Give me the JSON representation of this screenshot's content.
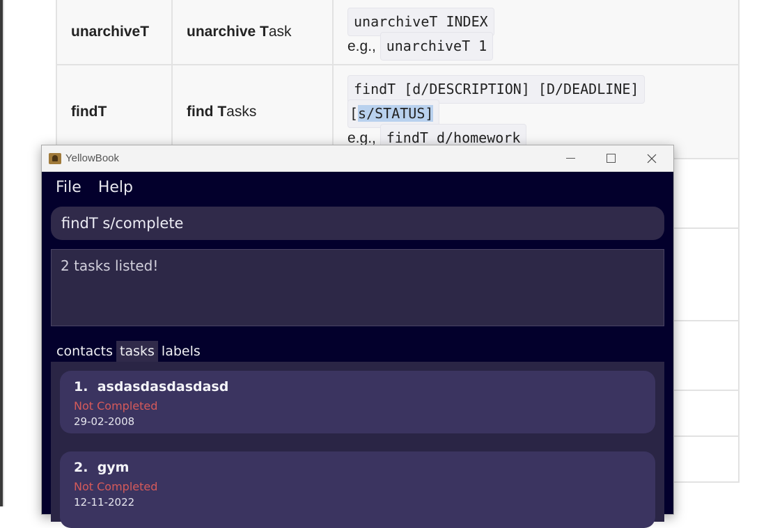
{
  "doc": {
    "rows": [
      {
        "command": "unarchiveT",
        "action_bold": "unarchive T",
        "action_rest": "ask",
        "format": "unarchiveT INDEX",
        "example_prefix": "e.g.,",
        "example": "unarchiveT 1"
      },
      {
        "command": "findT",
        "action_bold": "find T",
        "action_rest": "asks",
        "format_line1": "findT [d/DESCRIPTION] [D/DEADLINE]",
        "format_line2_pre": "[",
        "format_line2_sel": "s/STATUS]",
        "example_prefix": "e.g.,",
        "example": "findT d/homework"
      }
    ]
  },
  "window": {
    "title": "YellowBook",
    "menu": [
      "File",
      "Help"
    ],
    "command_input": "findT s/complete",
    "result_text": "2 tasks listed!",
    "tabs": [
      "contacts",
      "tasks",
      "labels"
    ],
    "active_tab": "tasks",
    "tasks": [
      {
        "index": "1.",
        "name": "asdasdasdasdasd",
        "status": "Not Completed",
        "deadline": "29-02-2008"
      },
      {
        "index": "2.",
        "name": "gym",
        "status": "Not Completed",
        "deadline": "12-11-2022"
      }
    ],
    "colors": {
      "background": "#03002c",
      "card": "#3b3460",
      "status_incomplete": "#d65a5a"
    }
  }
}
